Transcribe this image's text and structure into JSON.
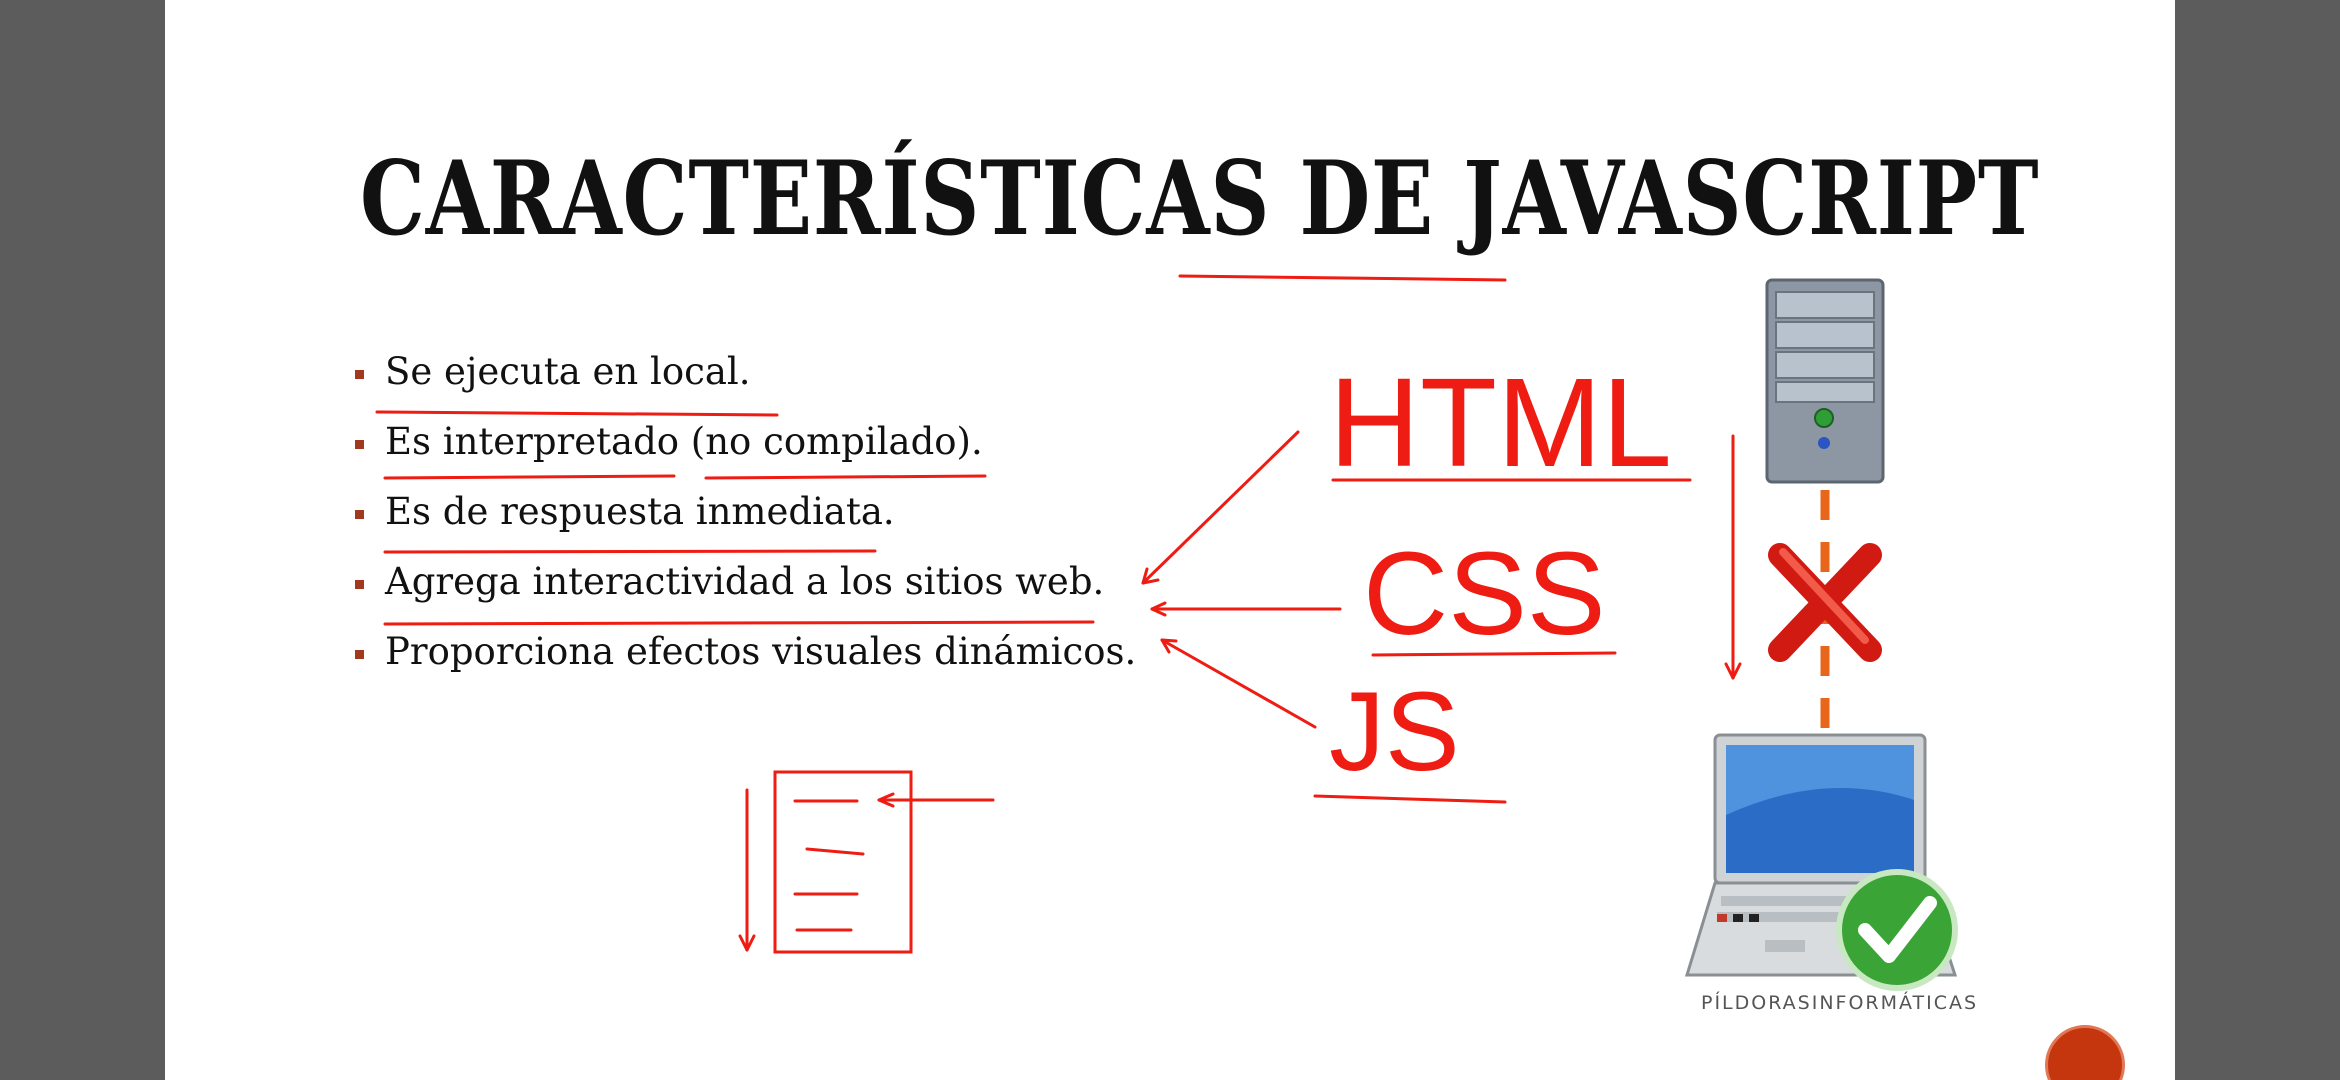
{
  "slide": {
    "title": "CARACTERÍSTICAS DE JAVASCRIPT",
    "bullets": [
      "Se ejecuta en local.",
      "Es interpretado (no compilado).",
      "Es de respuesta inmediata.",
      "Agrega interactividad a los sitios web.",
      "Proporciona efectos visuales dinámicos."
    ],
    "technologies": {
      "html": "HTML",
      "css": "CSS",
      "js": "JS"
    },
    "brand_watermark": "PÍLDORASINFORMÁTICAS"
  },
  "colors": {
    "annotation": "#ee1c12",
    "bullet_marker": "#a0391e",
    "background_side": "#5c5c5c"
  },
  "icons": [
    "server-tower-icon",
    "red-x-icon",
    "laptop-icon",
    "green-check-icon",
    "document-sketch-icon"
  ]
}
